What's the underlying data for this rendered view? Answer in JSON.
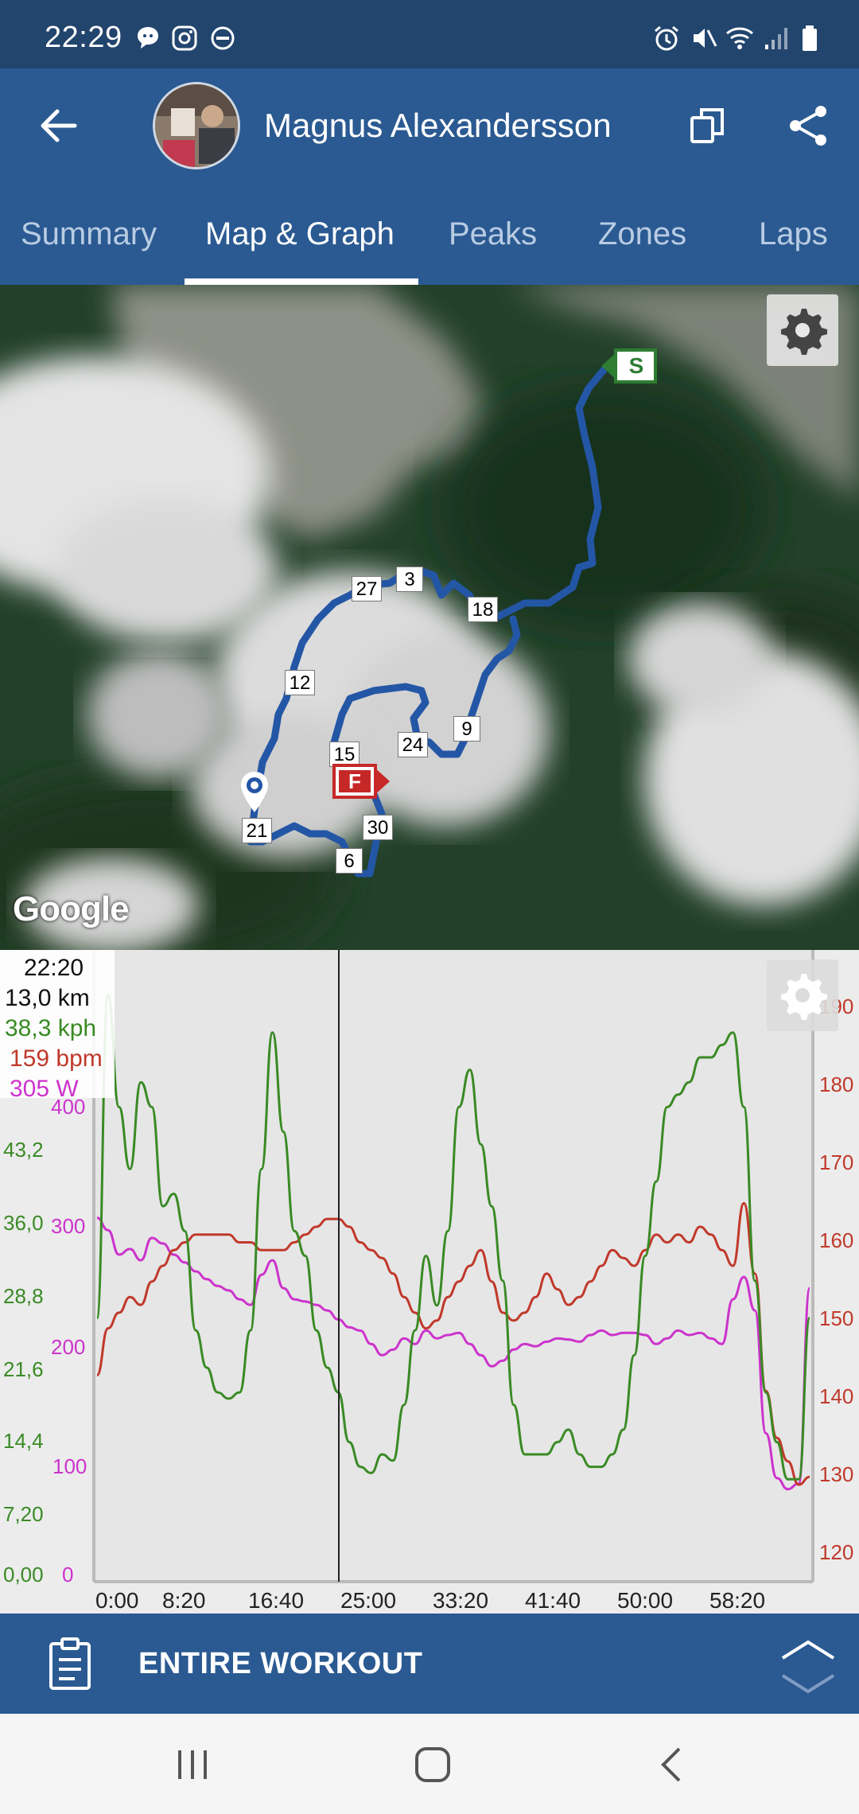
{
  "status_bar": {
    "time": "22:29"
  },
  "header": {
    "user_name": "Magnus Alexandersson"
  },
  "tabs": [
    {
      "label": "Summary"
    },
    {
      "label": "Map & Graph",
      "active": true
    },
    {
      "label": "Peaks"
    },
    {
      "label": "Zones"
    },
    {
      "label": "Laps"
    }
  ],
  "map": {
    "attribution": "Google",
    "km_markers": [
      "3",
      "27",
      "18",
      "12",
      "9",
      "24",
      "15",
      "30",
      "21",
      "6"
    ],
    "start_label": "S",
    "finish_label": "F",
    "route_color": "#2456a6"
  },
  "graph": {
    "readout": {
      "time": "22:20",
      "distance": "13,0 km",
      "speed": "38,3 kph",
      "heart_rate": "159 bpm",
      "power": "305 W"
    },
    "speed_axis_labels": [
      "0,00",
      "7,20",
      "14,4",
      "21,6",
      "28,8",
      "36,0",
      "43,2"
    ],
    "power_axis_labels": [
      "0",
      "100",
      "200",
      "300",
      "400"
    ],
    "hr_axis_labels": [
      "120",
      "130",
      "140",
      "150",
      "160",
      "170",
      "180",
      "190"
    ],
    "time_axis_labels": [
      "0:00",
      "8:20",
      "16:40",
      "25:00",
      "33:20",
      "41:40",
      "50:00",
      "58:20"
    ],
    "colors": {
      "speed": "#3a8a25",
      "heart_rate": "#c0392b",
      "power": "#cc33cc"
    }
  },
  "chart_data": {
    "type": "line",
    "x_unit": "minutes",
    "x": [
      0,
      1,
      2,
      3,
      4,
      5,
      6,
      7,
      8,
      9,
      10,
      11,
      12,
      13,
      14,
      15,
      16,
      17,
      18,
      19,
      20,
      21,
      22,
      23,
      24,
      25,
      26,
      27,
      28,
      29,
      30,
      31,
      32,
      33,
      34,
      35,
      36,
      37,
      38,
      39,
      40,
      41,
      42,
      43,
      44,
      45,
      46,
      47,
      48,
      49,
      50,
      51,
      52,
      53,
      54,
      55,
      56,
      57,
      58,
      59,
      60,
      61,
      62,
      63,
      64,
      65
    ],
    "x_tick_labels": [
      "0:00",
      "8:20",
      "16:40",
      "25:00",
      "33:20",
      "41:40",
      "50:00",
      "58:20"
    ],
    "series": [
      {
        "axis": "speed",
        "ylim": [
          0,
          50.4
        ],
        "values": [
          21,
          47,
          38,
          33,
          40,
          38,
          30,
          31,
          28,
          20,
          17,
          15,
          14.5,
          15,
          20,
          33,
          44,
          36,
          28,
          26,
          20,
          17,
          15,
          11,
          9,
          8.5,
          10,
          9.5,
          14,
          20,
          26,
          22,
          28,
          38,
          41,
          35,
          30,
          24,
          14,
          10,
          10,
          10,
          11,
          12,
          10,
          9,
          9,
          10,
          12,
          18,
          26,
          32,
          38,
          39,
          40,
          42,
          42,
          43,
          44,
          38,
          24,
          15,
          11,
          8,
          8,
          21
        ]
      },
      {
        "axis": "heart_rate",
        "ylim": [
          116,
          196
        ],
        "values": [
          142,
          148,
          150,
          152,
          151,
          154,
          156,
          158,
          159,
          160,
          160,
          160,
          160,
          159,
          159,
          158,
          158,
          158,
          159,
          160,
          161,
          162,
          162,
          161,
          159,
          158,
          157,
          155,
          152,
          150,
          148,
          149,
          152,
          154,
          156,
          158,
          154,
          150,
          149,
          150,
          152,
          155,
          153,
          151,
          152,
          154,
          156,
          158,
          157,
          156,
          158,
          160,
          159,
          160,
          159,
          161,
          160,
          158,
          156,
          164,
          155,
          140,
          134,
          131,
          128,
          129
        ]
      },
      {
        "axis": "power",
        "ylim": [
          0,
          560
        ],
        "values": [
          323,
          312,
          290,
          295,
          285,
          305,
          300,
          290,
          283,
          275,
          268,
          262,
          258,
          250,
          245,
          272,
          285,
          260,
          250,
          248,
          245,
          240,
          232,
          225,
          222,
          210,
          200,
          205,
          215,
          210,
          222,
          215,
          218,
          220,
          210,
          200,
          190,
          195,
          205,
          210,
          208,
          212,
          215,
          214,
          212,
          218,
          222,
          218,
          220,
          220,
          218,
          210,
          215,
          222,
          218,
          220,
          215,
          210,
          250,
          270,
          240,
          130,
          90,
          80,
          85,
          260
        ]
      }
    ],
    "speed_ylim": [
      0,
      50.4
    ],
    "power_ylim": [
      0,
      560
    ],
    "hr_ylim": [
      116,
      196
    ],
    "cursor_time": "22:20",
    "grid": false
  },
  "bottom_bar": {
    "label": "ENTIRE WORKOUT"
  }
}
